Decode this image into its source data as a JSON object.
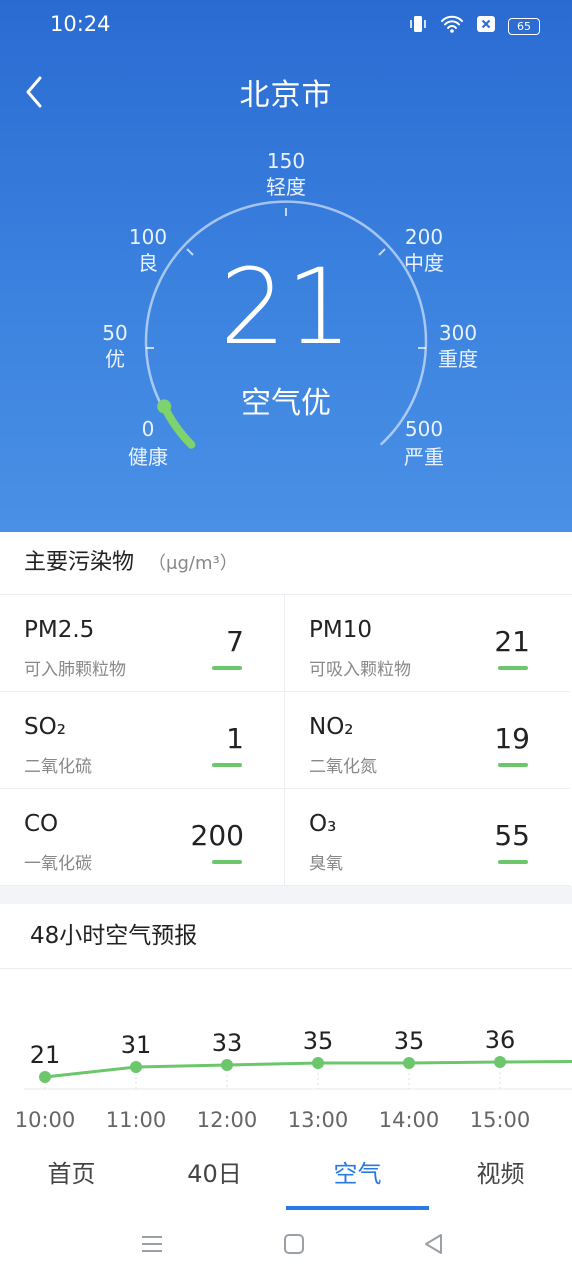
{
  "status_bar": {
    "time": "10:24",
    "battery": "65"
  },
  "header": {
    "city": "北京市"
  },
  "gauge": {
    "value": "21",
    "label": "空气优",
    "scale": [
      {
        "value": "0",
        "name": "健康"
      },
      {
        "value": "50",
        "name": "优"
      },
      {
        "value": "100",
        "name": "良"
      },
      {
        "value": "150",
        "name": "轻度"
      },
      {
        "value": "200",
        "name": "中度"
      },
      {
        "value": "300",
        "name": "重度"
      },
      {
        "value": "500",
        "name": "严重"
      }
    ]
  },
  "pollutants": {
    "title": "主要污染物",
    "unit": "（μg/m³）",
    "items": [
      {
        "name": "PM2.5",
        "desc": "可入肺颗粒物",
        "value": "7"
      },
      {
        "name": "PM10",
        "desc": "可吸入颗粒物",
        "value": "21"
      },
      {
        "name": "SO₂",
        "desc": "二氧化硫",
        "value": "1"
      },
      {
        "name": "NO₂",
        "desc": "二氧化氮",
        "value": "19"
      },
      {
        "name": "CO",
        "desc": "一氧化碳",
        "value": "200"
      },
      {
        "name": "O₃",
        "desc": "臭氧",
        "value": "55"
      }
    ]
  },
  "forecast": {
    "title": "48小时空气预报"
  },
  "chart_data": {
    "type": "line",
    "x": [
      "10:00",
      "11:00",
      "12:00",
      "13:00",
      "14:00",
      "15:00"
    ],
    "values": [
      21,
      31,
      33,
      35,
      35,
      36
    ]
  },
  "tabs": [
    {
      "label": "首页",
      "active": false
    },
    {
      "label": "40日",
      "active": false
    },
    {
      "label": "空气",
      "active": true
    },
    {
      "label": "视频",
      "active": false
    }
  ],
  "colors": {
    "accent": "#2a7ae4",
    "good": "#6cc66b",
    "hero_top": "#2a6bd2"
  }
}
